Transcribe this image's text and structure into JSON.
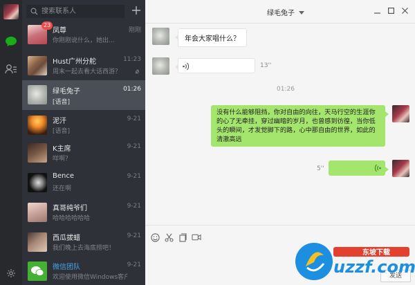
{
  "search": {
    "placeholder": "搜索联系人"
  },
  "conversations": [
    {
      "name": "凤尊",
      "preview": "你刚刚说什么，她出...",
      "time": "刚刚",
      "badge": "23",
      "avatar_colors": [
        "#f4d7d2",
        "#b84552"
      ]
    },
    {
      "name": "Hust广州分舵",
      "preview": "周末一起去看大话西游？",
      "time": "11:23",
      "muted": true,
      "avatar_colors": [
        "#6d4b3a",
        "#d9b48c"
      ]
    },
    {
      "name": "绿毛兔子",
      "preview": "[语音]",
      "time": "01:26",
      "active": true,
      "avatar_colors": [
        "#d2d4cf",
        "#8c908a"
      ]
    },
    {
      "name": "泥汗",
      "preview": "[语音]",
      "time": "9-21",
      "avatar_colors": [
        "#f08a2a",
        "#3a1e12"
      ]
    },
    {
      "name": "K主席",
      "preview": "咩啊？",
      "time": "9-21",
      "avatar_colors": [
        "#3d2a22",
        "#c8a58a"
      ]
    },
    {
      "name": "Bence",
      "preview": "还在啊",
      "time": "9-21",
      "avatar_colors": [
        "#111111",
        "#dddddd"
      ]
    },
    {
      "name": "真哥纯爷们",
      "preview": "哈哈哈哈哈哈",
      "time": "9-21",
      "avatar_colors": [
        "#efd7cf",
        "#9b7770"
      ]
    },
    {
      "name": "西瓜拔蜡",
      "preview": "我们晚上去海底捞吧！",
      "time": "9-21",
      "avatar_colors": [
        "#4a3832",
        "#e0c9bb"
      ]
    },
    {
      "name": "微信团队",
      "preview": "欢迎使用微信Windows客户端",
      "time": "9-21",
      "avatar_colors": [
        "#45b035",
        "#2f8a24"
      ]
    }
  ],
  "chat": {
    "title": "绿毛兔子",
    "messages": [
      {
        "text": "年会大家唱什么？"
      },
      {
        "duration": "13''"
      },
      {
        "time": "01:26"
      },
      {
        "text": "没有什么能够阻挡，你对自由的向往，天马行空的生涯你的心了无牵挂，穿过幽暗的岁月，也曾感到彷徨，当你低头的瞬间，才发觉脚下的路，心中那自由的世界，如此的清澈高远"
      },
      {
        "duration": "5''"
      }
    ]
  },
  "compose": {
    "send_label": "发送"
  },
  "watermark": {
    "brand": "uzzf.com",
    "slogan": "东坡下载"
  },
  "colors": {
    "accent_green": "#1aad19",
    "bubble_green": "#a3e56d",
    "badge_red": "#f14c4c"
  }
}
